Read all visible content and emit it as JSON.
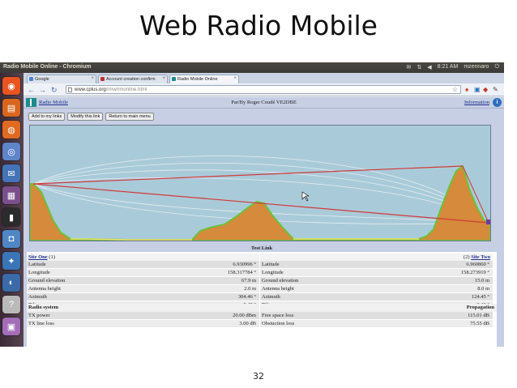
{
  "slide": {
    "title": "Web Radio Mobile",
    "page_number": "32"
  },
  "window": {
    "title": "Radio Mobile Online - Chromium",
    "tray": {
      "mail_icon": "✉",
      "network_icon": "⇅",
      "volume_icon": "◀",
      "time": "8:21 AM",
      "user": "mzennaro",
      "power_icon": "⏻"
    }
  },
  "launcher": {
    "items": [
      {
        "name": "ubuntu-icon",
        "glyph": "◉",
        "color": "#e95420"
      },
      {
        "name": "files-icon",
        "glyph": "▤",
        "color": "#d9661d"
      },
      {
        "name": "firefox-icon",
        "glyph": "◍",
        "color": "#e06a21"
      },
      {
        "name": "chromium-icon",
        "glyph": "◎",
        "color": "#5e84c9"
      },
      {
        "name": "thunderbird-icon",
        "glyph": "✉",
        "color": "#4573b8"
      },
      {
        "name": "remote-desktop-icon",
        "glyph": "▦",
        "color": "#7a4f8c"
      },
      {
        "name": "terminal-icon",
        "glyph": "▮",
        "color": "#2b2b2b"
      },
      {
        "name": "software-center-icon",
        "glyph": "◘",
        "color": "#4f86c6"
      },
      {
        "name": "network-tool-icon",
        "glyph": "✦",
        "color": "#3a75b6"
      },
      {
        "name": "email-client-icon",
        "glyph": "◐",
        "color": "#3b6aa8"
      },
      {
        "name": "help-icon",
        "glyph": "?",
        "color": "#b9b9b9"
      },
      {
        "name": "archive-icon",
        "glyph": "▣",
        "color": "#a36db8"
      }
    ]
  },
  "browser": {
    "tabs": [
      {
        "label": "Google",
        "favicon_color": "#4a7fd6"
      },
      {
        "label": "Account creation confirm",
        "favicon_color": "#c03030"
      },
      {
        "label": "Radio Mobile Online",
        "favicon_color": "#1d8b8b"
      }
    ],
    "url_host": "www.cplus.org",
    "url_path": "/rmw/rmonline.html",
    "back_icon": "←",
    "forward_icon": "→",
    "reload_icon": "↻",
    "star_icon": "☆",
    "wrench_icon": "✎"
  },
  "page": {
    "home_link": "Radio Mobile",
    "author": "Par/By Roger Coudé VE2DBE",
    "info_link": "Information",
    "buttons": {
      "add": "Add to my links",
      "modify": "Modify this link",
      "return": "Return to main menu"
    }
  },
  "link": {
    "title": "Test Link",
    "site_one": {
      "link_label": "Site One",
      "suffix": "(1)"
    },
    "site_two": {
      "prefix": "(2)",
      "link_label": "Site Two"
    },
    "left_rows": [
      {
        "k": "Latitude",
        "v": "6.930996 °"
      },
      {
        "k": "Longitude",
        "v": "158.317784 °"
      },
      {
        "k": "Ground elevation",
        "v": "67.9 m"
      },
      {
        "k": "Antenna height",
        "v": "2.0 m"
      },
      {
        "k": "Azimuth",
        "v": "304.46 °"
      },
      {
        "k": "Tilt",
        "v": "-0.48 °"
      }
    ],
    "right_rows": [
      {
        "k": "Latitude",
        "v": "6.960860 °"
      },
      {
        "k": "Longitude",
        "v": "158.273919 °"
      },
      {
        "k": "Ground elevation",
        "v": "15.0 m"
      },
      {
        "k": "Antenna height",
        "v": "8.0 m"
      },
      {
        "k": "Azimuth",
        "v": "124.45 °"
      },
      {
        "k": "Tilt",
        "v": "0.43 °"
      }
    ],
    "radio_system_label": "Radio system",
    "propagation_label": "Propagation",
    "left_rows2": [
      {
        "k": "TX power",
        "v": "20.00 dBm"
      },
      {
        "k": "TX line loss",
        "v": "3.00 dB"
      }
    ],
    "right_rows2": [
      {
        "k": "Free space loss",
        "v": "115.01 dB"
      },
      {
        "k": "Obstuction loss",
        "v": "75.55 dB"
      }
    ]
  }
}
